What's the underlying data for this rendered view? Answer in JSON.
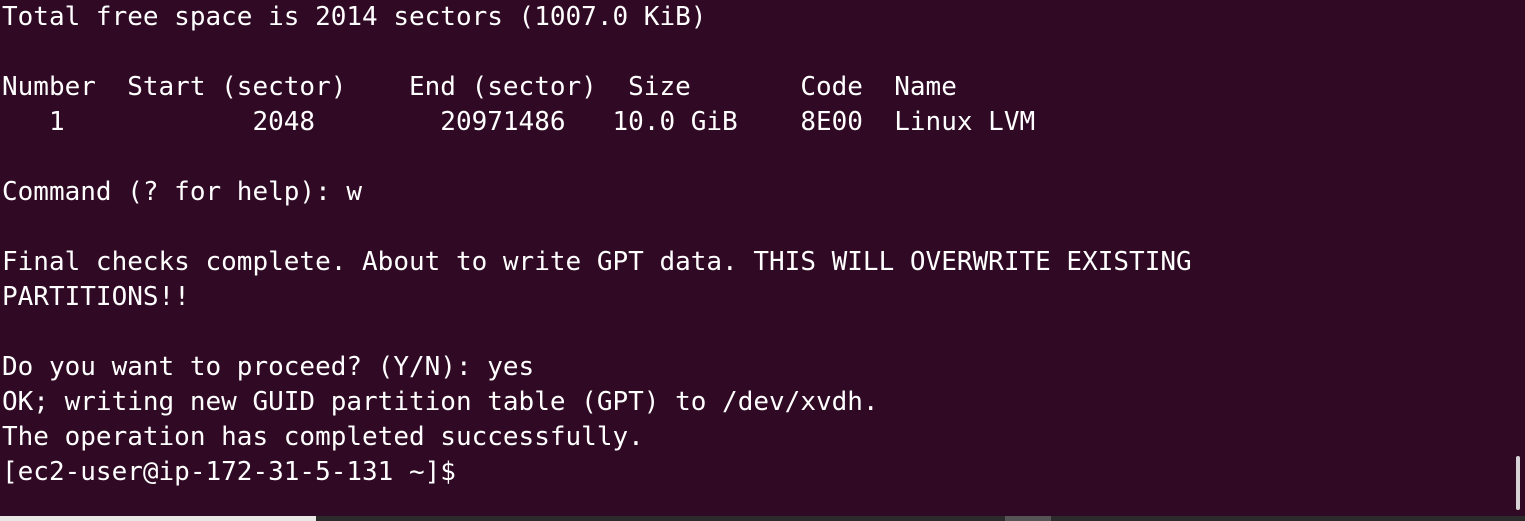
{
  "terminal": {
    "lines": [
      "Total free space is 2014 sectors (1007.0 KiB)",
      "",
      "Number  Start (sector)    End (sector)  Size       Code  Name",
      "   1            2048        20971486   10.0 GiB    8E00  Linux LVM",
      "",
      "Command (? for help): w",
      "",
      "Final checks complete. About to write GPT data. THIS WILL OVERWRITE EXISTING",
      "PARTITIONS!!",
      "",
      "Do you want to proceed? (Y/N): yes",
      "OK; writing new GUID partition table (GPT) to /dev/xvdh.",
      "The operation has completed successfully."
    ],
    "prompt": "[ec2-user@ip-172-31-5-131 ~]$ "
  },
  "colors": {
    "background": "#300a24",
    "foreground": "#ffffff"
  }
}
